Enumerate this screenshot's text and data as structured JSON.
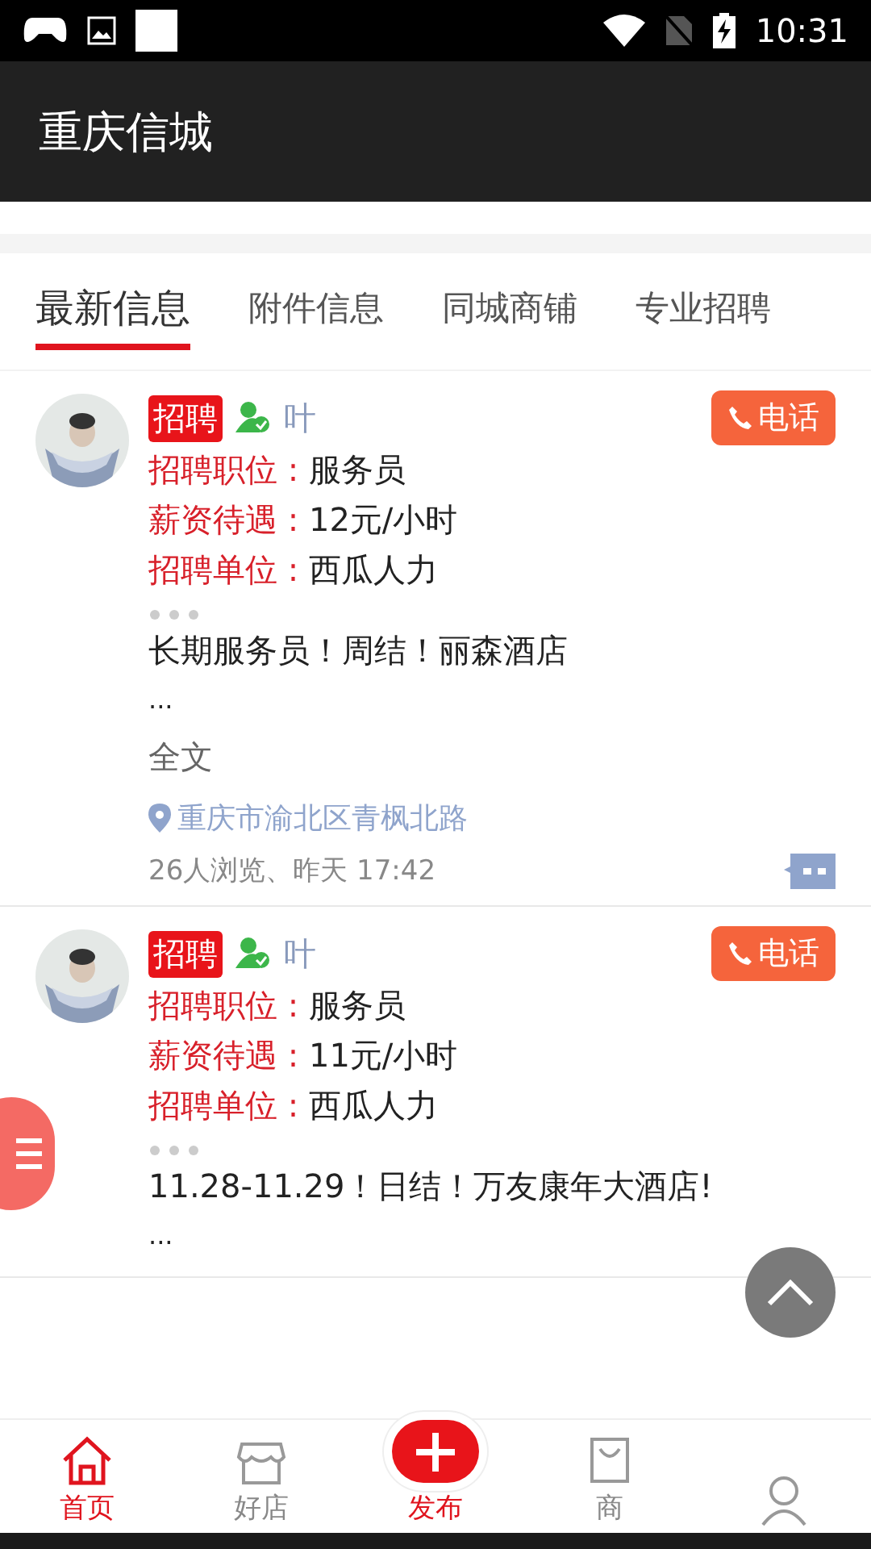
{
  "status_bar": {
    "time": "10:31"
  },
  "toolbar": {
    "title": "重庆信城"
  },
  "tabs": [
    {
      "label": "最新信息",
      "selected": true
    },
    {
      "label": "附件信息",
      "selected": false
    },
    {
      "label": "同城商铺",
      "selected": false
    },
    {
      "label": "专业招聘",
      "selected": false
    }
  ],
  "posts": [
    {
      "tag": "招聘",
      "user": "叶",
      "call": "电话",
      "fields": [
        {
          "label": "招聘职位",
          "sep": ":",
          "value": "服务员"
        },
        {
          "label": "薪资待遇",
          "sep": ":",
          "value": "12元/小时"
        },
        {
          "label": "招聘单位",
          "sep": ":",
          "value": "西瓜人力"
        }
      ],
      "description": "长期服务员！周结！丽森酒店",
      "more": "...",
      "full_text": "全文",
      "address": "重庆市渝北区青枫北路",
      "meta": "26人浏览、昨天 17:42"
    },
    {
      "tag": "招聘",
      "user": "叶",
      "call": "电话",
      "fields": [
        {
          "label": "招聘职位",
          "sep": ":",
          "value": "服务员"
        },
        {
          "label": "薪资待遇",
          "sep": ":",
          "value": "11元/小时"
        },
        {
          "label": "招聘单位",
          "sep": ":",
          "value": "西瓜人力"
        }
      ],
      "description": "11.28-11.29！日结！万友康年大酒店!",
      "more": "..."
    }
  ],
  "bottom_nav": [
    {
      "kind": "home",
      "label": "首页",
      "selected": true
    },
    {
      "kind": "shop",
      "label": "好店",
      "selected": false
    },
    {
      "kind": "publish",
      "label": "发布",
      "selected": false
    },
    {
      "kind": "bag",
      "label": "商",
      "selected": false
    },
    {
      "kind": "user",
      "selected": false
    }
  ]
}
